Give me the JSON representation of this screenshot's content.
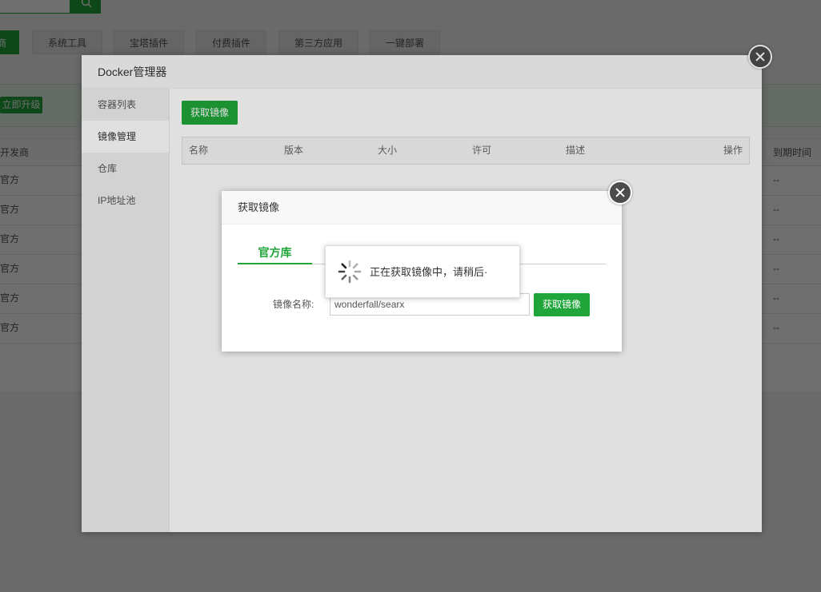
{
  "background": {
    "tabs": [
      {
        "label": "商",
        "active": true
      },
      {
        "label": "系统工具"
      },
      {
        "label": "宝塔插件"
      },
      {
        "label": "付费插件"
      },
      {
        "label": "第三方应用"
      },
      {
        "label": "一键部署"
      }
    ],
    "upgrade_label": "立即升级",
    "table": {
      "col_developer": "开发商",
      "col_expiry": "到期时间",
      "rows": [
        {
          "developer": "官方",
          "expiry": "--"
        },
        {
          "developer": "官方",
          "expiry": "--"
        },
        {
          "developer": "官方",
          "expiry": "--"
        },
        {
          "developer": "官方",
          "expiry": "--"
        },
        {
          "developer": "官方",
          "expiry": "--"
        },
        {
          "developer": "官方",
          "expiry": "--"
        }
      ]
    }
  },
  "docker": {
    "title": "Docker管理器",
    "sidebar": [
      "容器列表",
      "镜像管理",
      "仓库",
      "IP地址池"
    ],
    "active_item": "镜像管理",
    "get_image_button": "获取镜像",
    "columns": [
      "名称",
      "版本",
      "大小",
      "许可",
      "描述",
      "操作"
    ]
  },
  "pull_dialog": {
    "title": "获取镜像",
    "tab": "官方库",
    "name_label": "镜像名称:",
    "name_value": "wonderfall/searx",
    "submit_label": "获取镜像"
  },
  "loading": {
    "message": "正在获取镜像中，请稍后·"
  },
  "colors": {
    "accent": "#20a53a"
  }
}
